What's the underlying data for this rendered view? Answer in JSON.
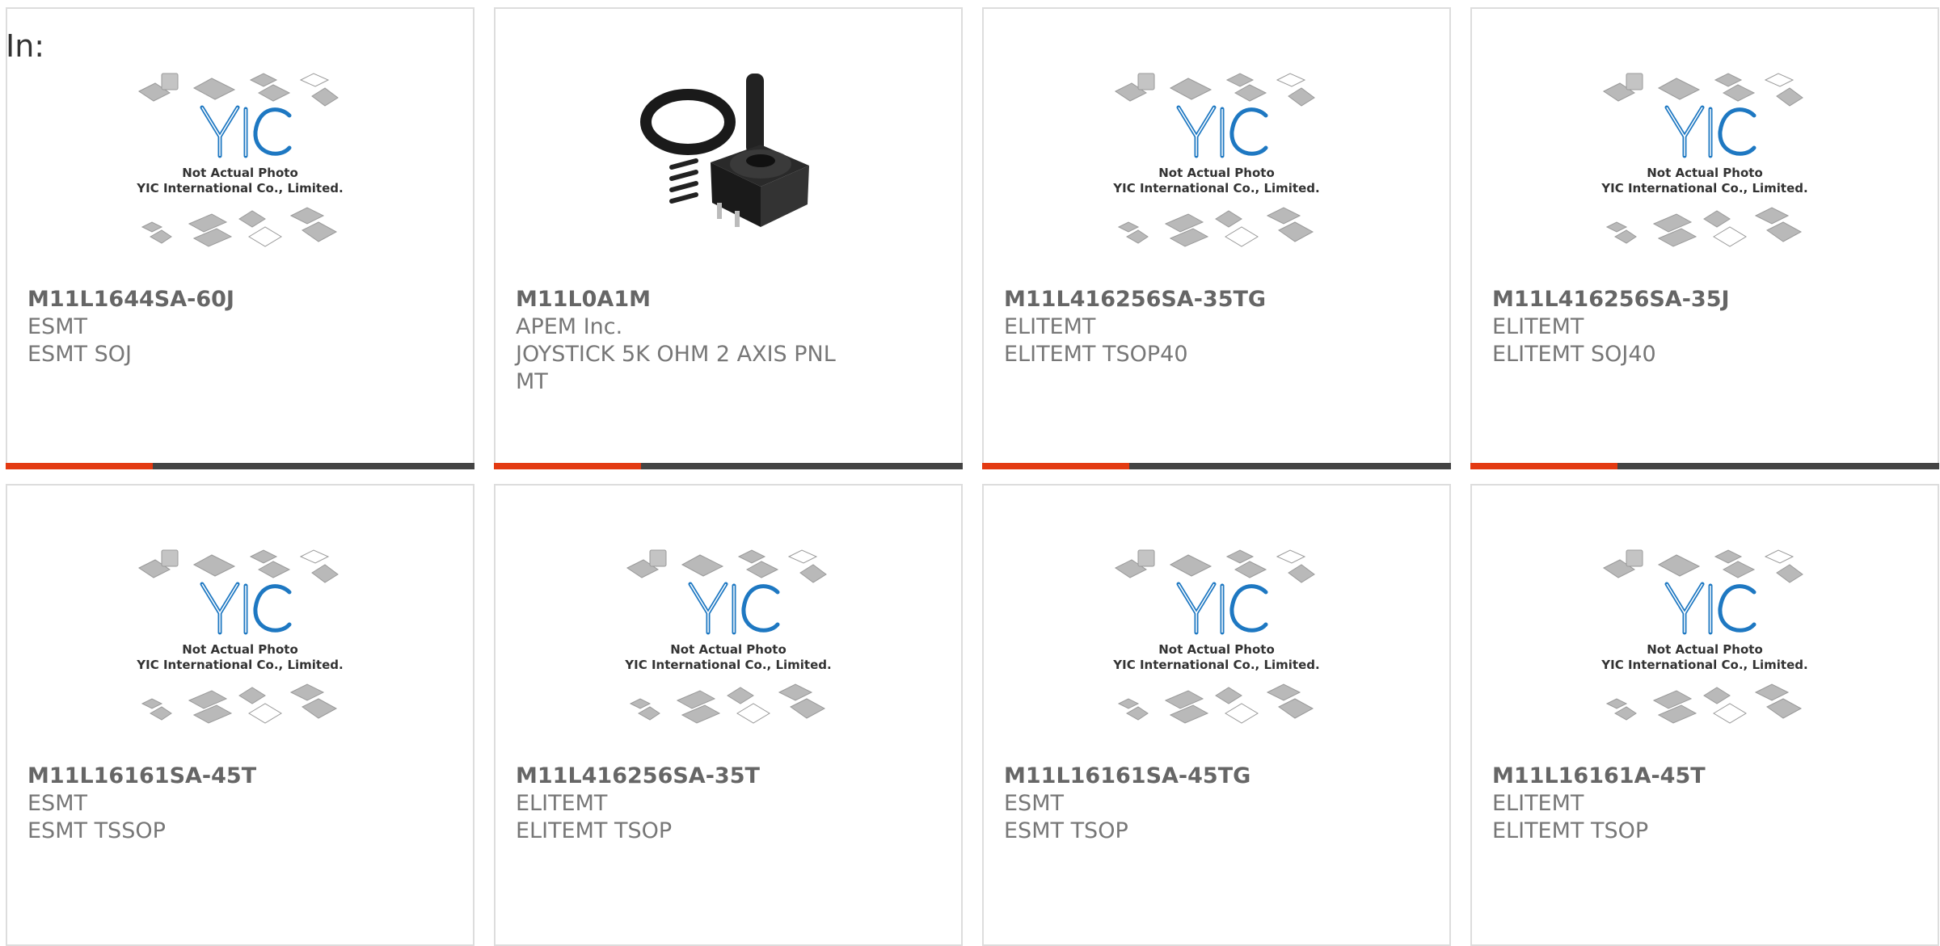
{
  "header": {
    "in_label": "In:"
  },
  "colors": {
    "accent": "#e33a12",
    "bar": "#444444",
    "logo_blue": "#1e78c2",
    "text": "#777777"
  },
  "placeholder": {
    "line1": "Not Actual Photo",
    "line2": "YIC International Co., Limited."
  },
  "cards": [
    {
      "part": "M11L1644SA-60J",
      "maker": "ESMT",
      "desc": "ESMT SOJ",
      "image": "placeholder",
      "bar": true
    },
    {
      "part": "M11L0A1M",
      "maker": "APEM Inc.",
      "desc": "JOYSTICK 5K OHM 2 AXIS PNL MT",
      "image": "joystick-photo",
      "bar": true
    },
    {
      "part": "M11L416256SA-35TG",
      "maker": "ELITEMT",
      "desc": "ELITEMT TSOP40",
      "image": "placeholder",
      "bar": true
    },
    {
      "part": "M11L416256SA-35J",
      "maker": "ELITEMT",
      "desc": "ELITEMT SOJ40",
      "image": "placeholder",
      "bar": true
    },
    {
      "part": "M11L16161SA-45T",
      "maker": "ESMT",
      "desc": "ESMT TSSOP",
      "image": "placeholder",
      "bar": false
    },
    {
      "part": "M11L416256SA-35T",
      "maker": "ELITEMT",
      "desc": "ELITEMT TSOP",
      "image": "placeholder",
      "bar": false
    },
    {
      "part": "M11L16161SA-45TG",
      "maker": "ESMT",
      "desc": "ESMT TSOP",
      "image": "placeholder",
      "bar": false
    },
    {
      "part": "M11L16161A-45T",
      "maker": "ELITEMT",
      "desc": "ELITEMT TSOP",
      "image": "placeholder",
      "bar": false
    }
  ]
}
